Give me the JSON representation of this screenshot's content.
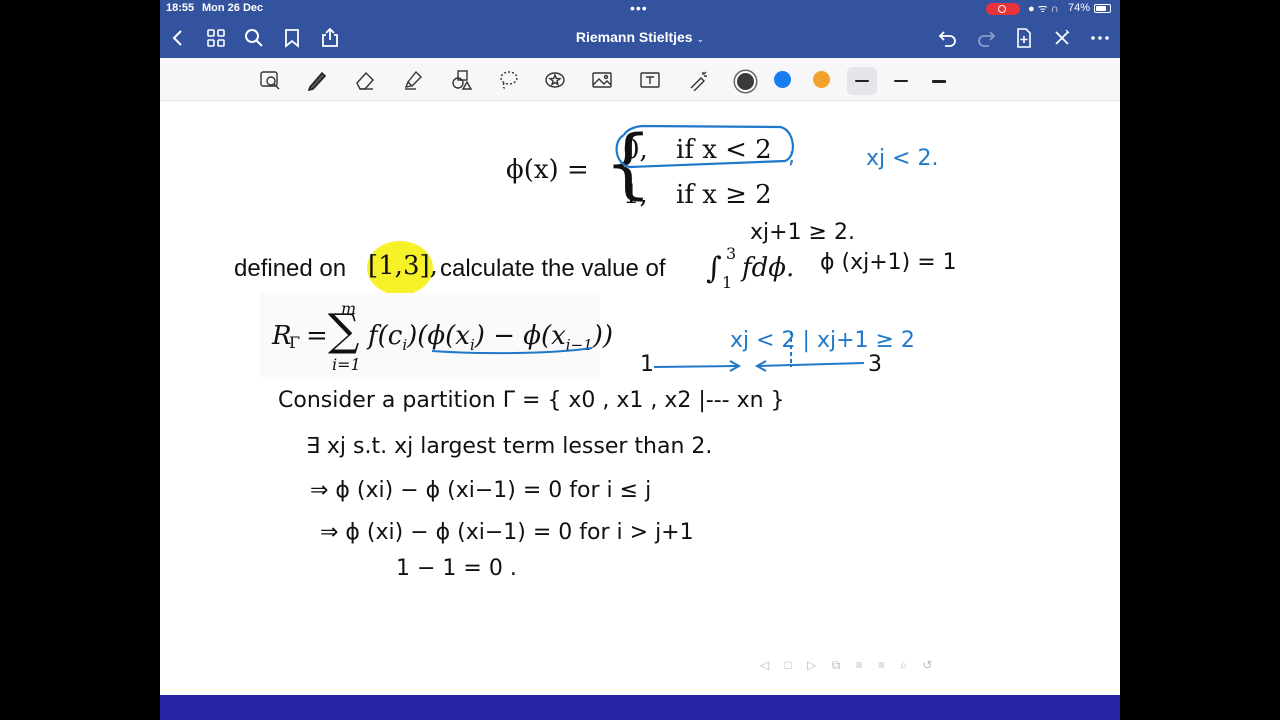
{
  "status": {
    "time": "18:55",
    "date": "Mon 26 Dec",
    "battery_pct": "74%",
    "battery_level": 0.74
  },
  "nav": {
    "title": "Riemann Stieltjes",
    "icons": [
      "back-icon",
      "grid-icon",
      "search-icon",
      "bookmark-icon",
      "share-icon",
      "undo-icon",
      "redo-icon",
      "add-page-icon",
      "close-icon",
      "more-icon"
    ]
  },
  "toolbar": {
    "tools": [
      "lasso-zoom-icon",
      "pen-icon",
      "eraser-icon",
      "highlighter-icon",
      "shapes-icon",
      "lasso-icon",
      "sticker-icon",
      "image-icon",
      "text-icon",
      "laser-pointer-icon"
    ],
    "colors": [
      "#3a3a3a",
      "#1a7cf0",
      "#f2a12b"
    ],
    "selected_color_index": 0
  },
  "page": {
    "phi_lhs": "ϕ(x) =",
    "case1_val": "0,",
    "case1_cond": "if x < 2",
    "case2_val": "1,",
    "case2_cond": "if x ≥ 2",
    "line2_a": "defined on",
    "interval": "[1,3],",
    "line2_b": "calculate the value of",
    "integral_upper": "3",
    "integral_lower": "1",
    "integrand": "fdϕ.",
    "sum_lhs": "R",
    "sum_sub": "Γ",
    "sum_top": "m",
    "sum_bottom": "i=1",
    "sum_body_a": "f(c",
    "sum_body_b": "i",
    "sum_body_c": ")(ϕ(x",
    "sum_body_d": ") − ϕ(x",
    "sum_body_e": "i−1",
    "sum_body_f": "))"
  },
  "handwriting": {
    "xj_lt2": "xj < 2.",
    "xj1_ge2": "xj+1 ≥ 2.",
    "phi_xj1": "ϕ (xj+1) = 1",
    "number_line": "xj < 2 | xj+1 ≥ 2",
    "nl_left": "1",
    "nl_right": "3",
    "partition": "Consider a partition Γ = { x0 , x1 , x2 |--- xn }",
    "exists": "∃ xj s.t. xj largest term lesser than 2.",
    "implies1": "⇒ ϕ (xi) − ϕ (xi−1) = 0  for i ≤ j",
    "implies2": "⇒ ϕ (xi) − ϕ (xi−1) = 0  for i > j+1",
    "last": "1  −  1     = 0  ."
  }
}
